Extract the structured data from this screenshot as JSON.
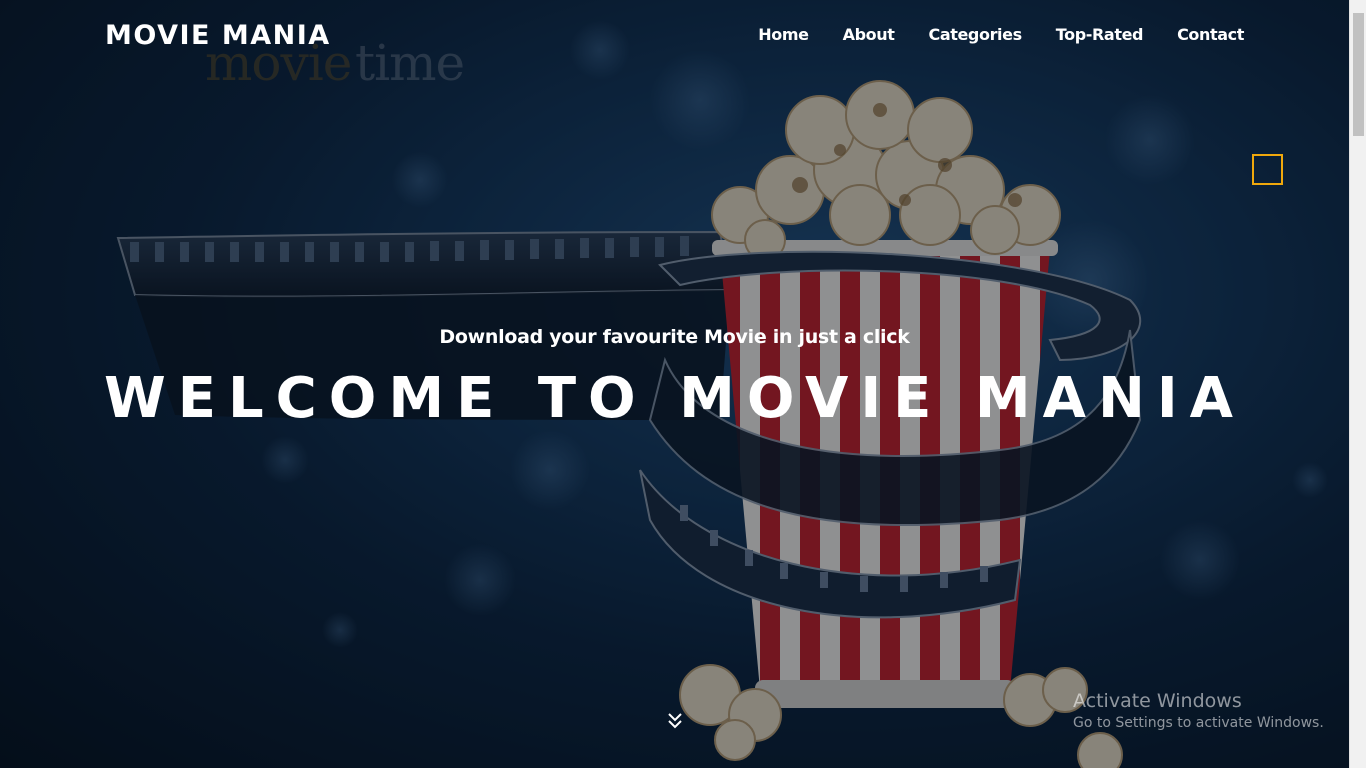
{
  "header": {
    "brand": "MOVIE MANIA",
    "nav": [
      {
        "label": "Home"
      },
      {
        "label": "About"
      },
      {
        "label": "Categories"
      },
      {
        "label": "Top-Rated"
      },
      {
        "label": "Contact"
      }
    ]
  },
  "hero": {
    "background_logo_part1": "movie",
    "background_logo_part2": "time",
    "tagline": "Download your favourite Movie in just a click",
    "title": "WELCOME TO MOVIE MANIA",
    "accent_color": "#f0a80c",
    "scroll_icon": "double-chevron-down-icon"
  },
  "watermark": {
    "title": "Activate Windows",
    "subtitle": "Go to Settings to activate Windows."
  }
}
